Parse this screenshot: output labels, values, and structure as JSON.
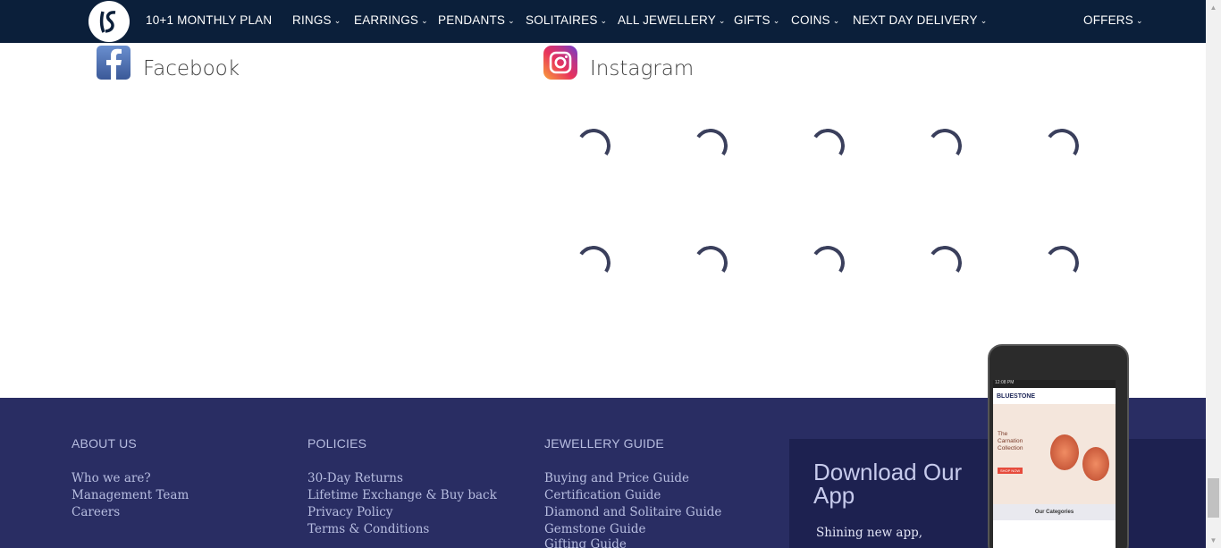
{
  "nav": {
    "items": [
      {
        "label": "10+1 MONTHLY PLAN",
        "has_dropdown": false
      },
      {
        "label": "RINGS",
        "has_dropdown": true
      },
      {
        "label": "EARRINGS",
        "has_dropdown": true
      },
      {
        "label": "PENDANTS",
        "has_dropdown": true
      },
      {
        "label": "SOLITAIRES",
        "has_dropdown": true
      },
      {
        "label": "ALL JEWELLERY",
        "has_dropdown": true
      },
      {
        "label": "GIFTS",
        "has_dropdown": true
      },
      {
        "label": "COINS",
        "has_dropdown": true
      },
      {
        "label": "NEXT DAY DELIVERY",
        "has_dropdown": true
      },
      {
        "label": "OFFERS",
        "has_dropdown": true
      }
    ],
    "chevron": "⌄"
  },
  "social": {
    "facebook": {
      "title": "Facebook",
      "icon": "facebook-icon"
    },
    "instagram": {
      "title": "Instagram",
      "icon": "instagram-icon"
    }
  },
  "footer": {
    "about": {
      "heading": "ABOUT US",
      "links": [
        "Who we are?",
        "Management Team",
        "Careers"
      ]
    },
    "policies": {
      "heading": "POLICIES",
      "links": [
        "30-Day Returns",
        "Lifetime Exchange & Buy back",
        "Privacy Policy",
        "Terms & Conditions"
      ]
    },
    "guide": {
      "heading": "JEWELLERY GUIDE",
      "links": [
        "Buying and Price Guide",
        "Certification Guide",
        "Diamond and Solitaire Guide",
        "Gemstone Guide",
        "Gifting Guide"
      ]
    },
    "app": {
      "title": "Download Our App",
      "subtitle": "Shining new app,"
    }
  },
  "phone": {
    "status": "12:08 PM",
    "brand": "BLUESTONE",
    "hero_title": "The Carnation Collection",
    "hero_button": "SHOP NOW",
    "categories_label": "Our Categories"
  },
  "colors": {
    "nav_bg": "#0b1f3a",
    "footer_bg": "#292d63",
    "app_box_bg": "#1d2150"
  }
}
